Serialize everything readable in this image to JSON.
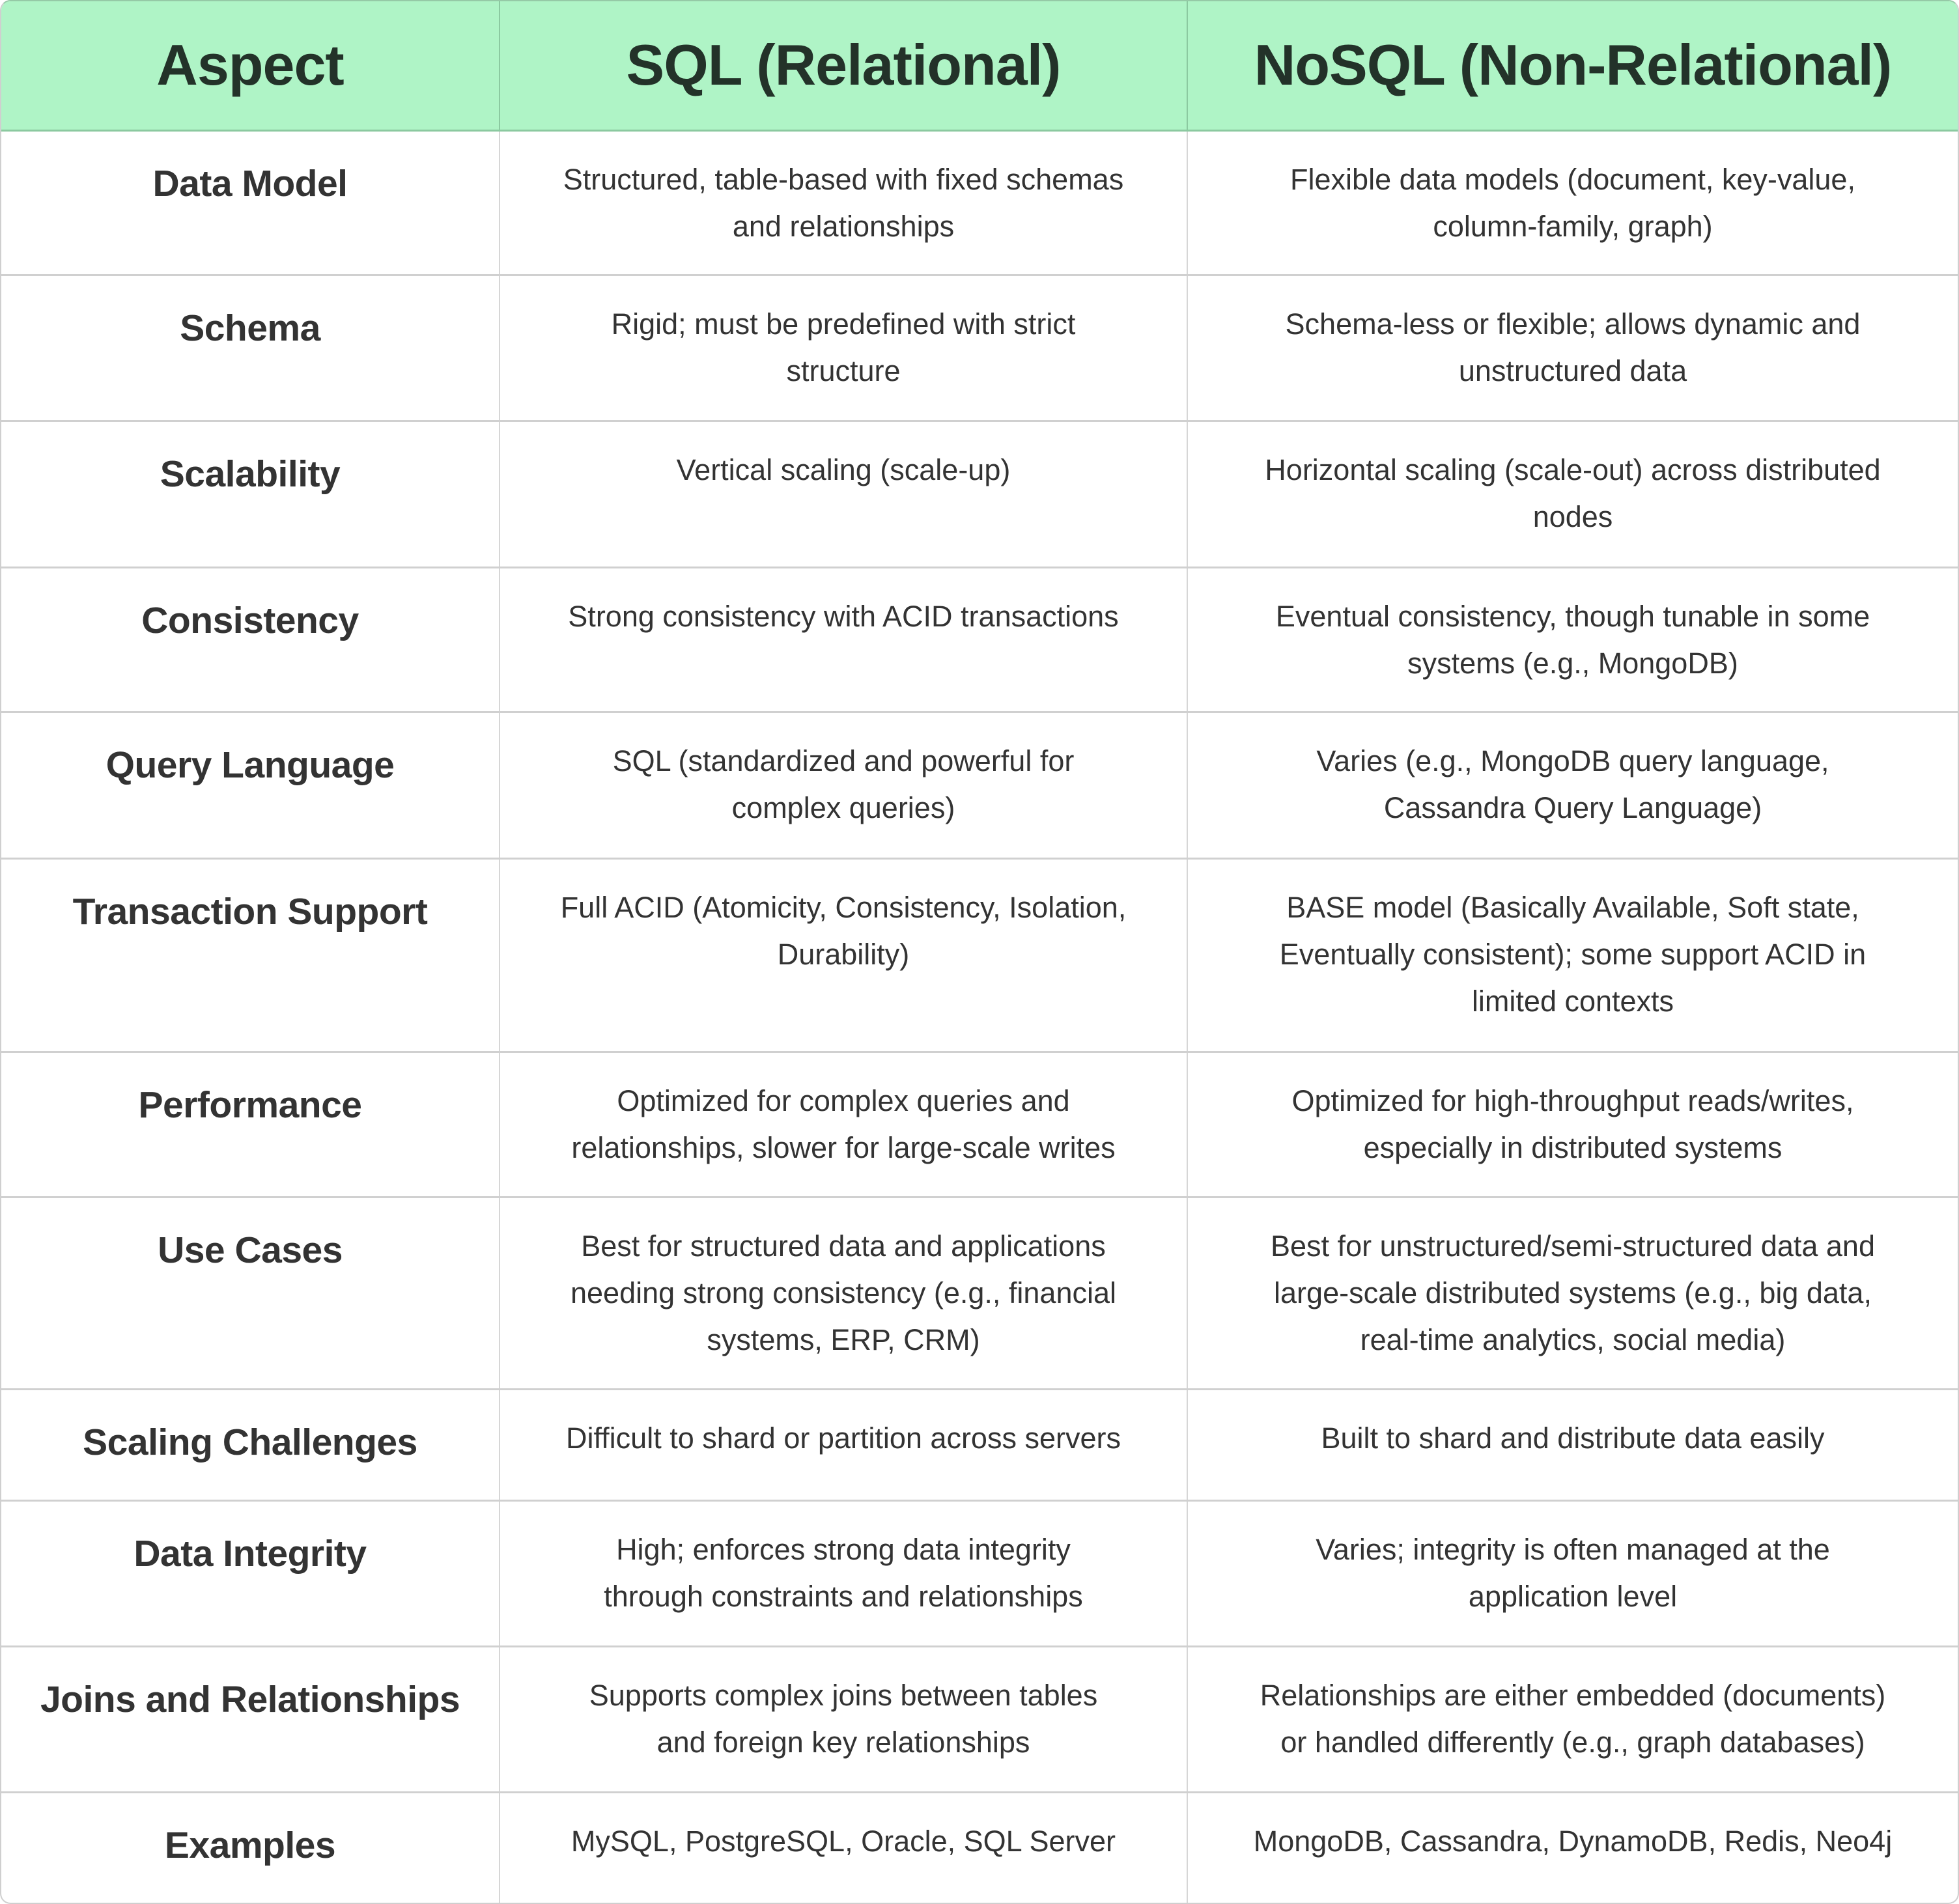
{
  "colors": {
    "header_background": "#aff4c6",
    "header_text": "#233229",
    "body_text": "#333333",
    "grid_line": "#d0d0d0"
  },
  "table": {
    "headers": [
      "Aspect",
      "SQL (Relational)",
      "NoSQL (Non-Relational)"
    ],
    "rows": [
      {
        "aspect": "Data Model",
        "sql": [
          "Structured, table-based with fixed schemas",
          "and relationships"
        ],
        "nosql": [
          "Flexible data models (document, key-value,",
          "column-family, graph)"
        ]
      },
      {
        "aspect": "Schema",
        "sql": [
          "Rigid; must be predefined with strict",
          "structure"
        ],
        "nosql": [
          "Schema-less or flexible; allows dynamic and",
          "unstructured data"
        ]
      },
      {
        "aspect": "Scalability",
        "sql": [
          "Vertical scaling (scale-up)"
        ],
        "nosql": [
          "Horizontal scaling (scale-out) across distributed",
          "nodes"
        ]
      },
      {
        "aspect": "Consistency",
        "sql": [
          "Strong consistency with ACID transactions"
        ],
        "nosql": [
          "Eventual consistency, though tunable in some",
          "systems (e.g., MongoDB)"
        ]
      },
      {
        "aspect": "Query Language",
        "sql": [
          "SQL (standardized and powerful for",
          "complex queries)"
        ],
        "nosql": [
          "Varies (e.g., MongoDB query language,",
          "Cassandra Query Language)"
        ]
      },
      {
        "aspect": "Transaction Support",
        "sql": [
          "Full ACID (Atomicity, Consistency, Isolation,",
          "Durability)"
        ],
        "nosql": [
          "BASE model (Basically Available, Soft state,",
          "Eventually consistent); some support ACID in",
          "limited contexts"
        ]
      },
      {
        "aspect": "Performance",
        "sql": [
          "Optimized for complex queries and",
          "relationships, slower for large-scale writes"
        ],
        "nosql": [
          "Optimized for high-throughput reads/writes,",
          "especially in distributed systems"
        ]
      },
      {
        "aspect": "Use Cases",
        "sql": [
          "Best for structured data and applications",
          "needing strong consistency (e.g., financial",
          "systems, ERP, CRM)"
        ],
        "nosql": [
          "Best for unstructured/semi-structured data and",
          "large-scale distributed systems (e.g., big data,",
          "real-time analytics, social media)"
        ]
      },
      {
        "aspect": "Scaling Challenges",
        "sql": [
          "Difficult to shard or partition across servers"
        ],
        "nosql": [
          "Built to shard and distribute data easily"
        ]
      },
      {
        "aspect": "Data Integrity",
        "sql": [
          "High; enforces strong data integrity",
          "through constraints and relationships"
        ],
        "nosql": [
          "Varies; integrity is often managed at the",
          "application level"
        ]
      },
      {
        "aspect": "Joins and Relationships",
        "sql": [
          "Supports complex joins between tables",
          "and foreign key relationships"
        ],
        "nosql": [
          "Relationships are either embedded (documents)",
          "or handled differently (e.g., graph databases)"
        ]
      },
      {
        "aspect": "Examples",
        "sql": [
          "MySQL, PostgreSQL, Oracle, SQL Server"
        ],
        "nosql": [
          "MongoDB, Cassandra, DynamoDB, Redis, Neo4j"
        ]
      }
    ]
  }
}
